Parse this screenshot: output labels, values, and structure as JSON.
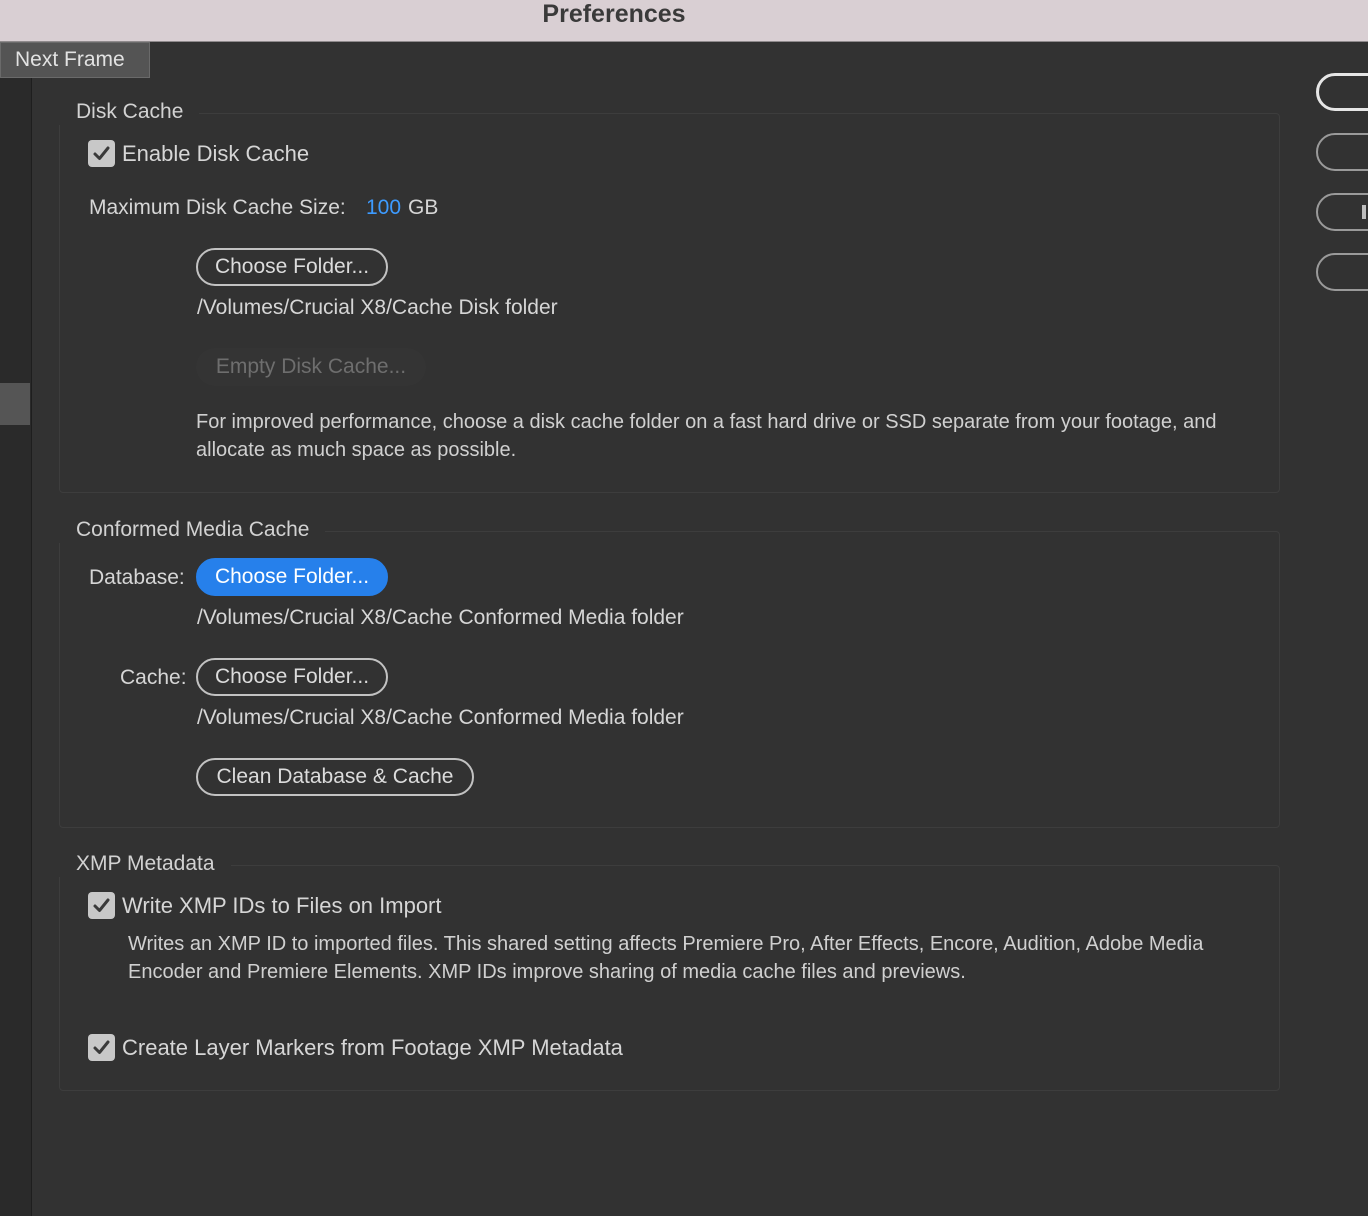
{
  "window": {
    "title": "Preferences"
  },
  "tooltip": {
    "text": "Next Frame"
  },
  "disk_cache": {
    "section_label": "Disk Cache",
    "enable_label": "Enable Disk Cache",
    "enable_checked": true,
    "max_size_label": "Maximum Disk Cache Size:",
    "max_size_value": "100",
    "max_size_unit": "GB",
    "choose_folder_label": "Choose Folder...",
    "folder_path": "/Volumes/Crucial X8/Cache Disk folder",
    "empty_cache_label": "Empty Disk Cache...",
    "help_text_line1": "For improved performance, choose a disk cache folder on a fast hard drive or SSD separate from your footage, and",
    "help_text_line2": "allocate as much space as possible."
  },
  "conformed_media_cache": {
    "section_label": "Conformed Media Cache",
    "database_label": "Database:",
    "database_button_label": "Choose Folder...",
    "database_path": "/Volumes/Crucial X8/Cache Conformed Media folder",
    "cache_label": "Cache:",
    "cache_button_label": "Choose Folder...",
    "cache_path": "/Volumes/Crucial X8/Cache Conformed Media folder",
    "clean_button_label": "Clean Database & Cache"
  },
  "xmp_metadata": {
    "section_label": "XMP Metadata",
    "write_ids_label": "Write XMP IDs to Files on Import",
    "write_ids_checked": true,
    "write_ids_desc_line1": "Writes an XMP ID to imported files. This shared setting affects Premiere Pro, After Effects, Encore, Audition, Adobe Media",
    "write_ids_desc_line2": "Encoder and Premiere Elements. XMP IDs improve sharing of media cache files and previews.",
    "layer_markers_label": "Create Layer Markers from Footage XMP Metadata",
    "layer_markers_checked": true
  },
  "colors": {
    "background": "#323232",
    "accent_blue": "#2680eb",
    "value_blue": "#3d9bff"
  }
}
